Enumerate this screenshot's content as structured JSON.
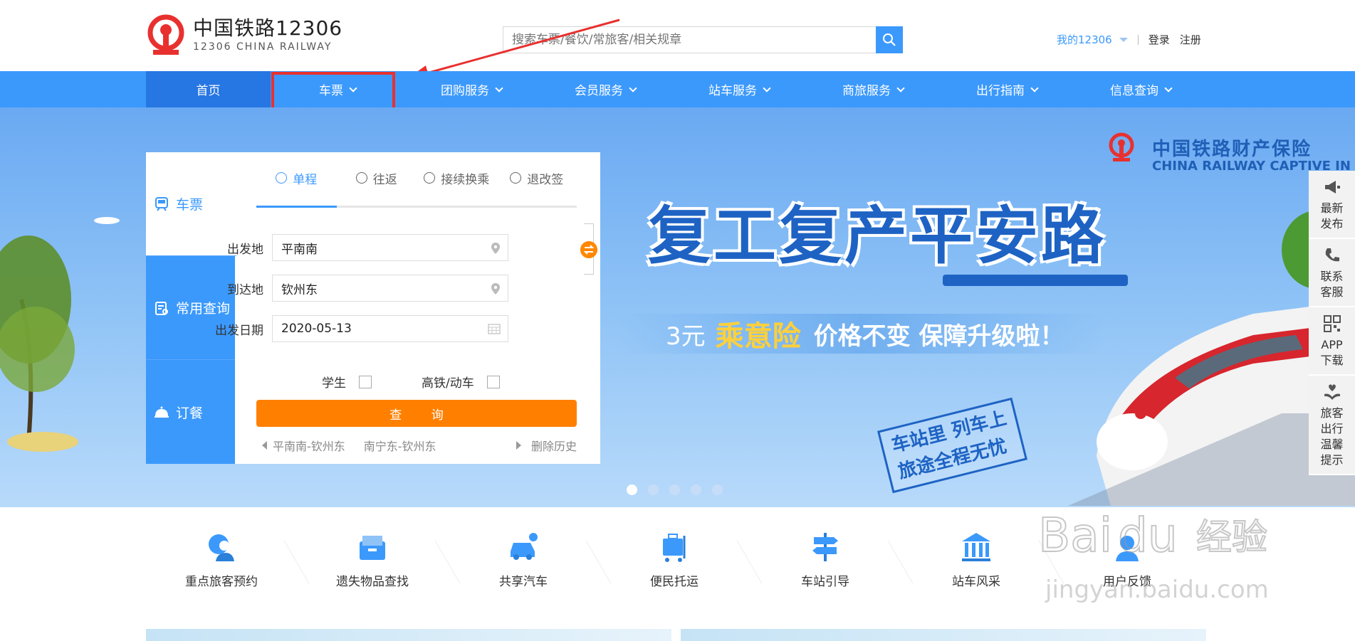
{
  "brand": {
    "name_cn": "中国铁路12306",
    "name_en": "12306 CHINA RAILWAY",
    "logo_color": "#e8312f"
  },
  "search": {
    "placeholder": "搜索车票/餐饮/常旅客/相关规章",
    "icon": "search-icon"
  },
  "top_links": {
    "my": "我的12306",
    "login": "登录",
    "register": "注册"
  },
  "nav": {
    "items": [
      {
        "label": "首页",
        "dropdown": false
      },
      {
        "label": "车票",
        "dropdown": true
      },
      {
        "label": "团购服务",
        "dropdown": true
      },
      {
        "label": "会员服务",
        "dropdown": true
      },
      {
        "label": "站车服务",
        "dropdown": true
      },
      {
        "label": "商旅服务",
        "dropdown": true
      },
      {
        "label": "出行指南",
        "dropdown": true
      },
      {
        "label": "信息查询",
        "dropdown": true
      }
    ],
    "accent": "#3b99fc",
    "active_bg": "#2676e3"
  },
  "booking": {
    "side_tabs": [
      {
        "label": "车票",
        "icon": "train-icon"
      },
      {
        "label": "常用查询",
        "icon": "clipboard-search-icon"
      },
      {
        "label": "订餐",
        "icon": "dining-bell-icon"
      }
    ],
    "trip_tabs": [
      {
        "label": "单程",
        "icon": "arrow-circle-icon"
      },
      {
        "label": "往返",
        "icon": "roundtrip-icon"
      },
      {
        "label": "接续换乘",
        "icon": "transfer-icon"
      },
      {
        "label": "退改签",
        "icon": "refund-icon"
      }
    ],
    "from_label": "出发地",
    "from_value": "平南南",
    "to_label": "到达地",
    "to_value": "钦州东",
    "date_label": "出发日期",
    "date_value": "2020-05-13",
    "student_label": "学生",
    "highspeed_label": "高铁/动车",
    "query_label": "查 询",
    "history": [
      "平南南-钦州东",
      "南宁东-钦州东"
    ],
    "delete_history": "删除历史",
    "query_color": "#ff8000"
  },
  "banner": {
    "insurer_cn": "中国铁路财产保险",
    "insurer_en": "CHINA RAILWAY CAPTIVE IN",
    "headline": "复工复产平安路",
    "subline_prefix": "3元",
    "subline_highlight": "乘意险",
    "subline_suffix": "价格不变 保障升级啦！",
    "badge_line1": "车站里 列车上",
    "badge_line2": "旅途全程无忧",
    "carousel_count": 5,
    "carousel_active": 1
  },
  "float_bar": [
    {
      "label": "最新发布",
      "icon": "megaphone-icon"
    },
    {
      "label": "联系客服",
      "icon": "phone-icon"
    },
    {
      "label": "APP下载",
      "icon": "qr-code-icon"
    },
    {
      "label": "旅客出行温馨提示",
      "icon": "heart-hands-icon"
    }
  ],
  "services": [
    {
      "label": "重点旅客预约",
      "icon": "priority-passenger-icon"
    },
    {
      "label": "遗失物品查找",
      "icon": "lost-found-icon"
    },
    {
      "label": "共享汽车",
      "icon": "shared-car-icon"
    },
    {
      "label": "便民托运",
      "icon": "luggage-cart-icon"
    },
    {
      "label": "车站引导",
      "icon": "signpost-icon"
    },
    {
      "label": "站车风采",
      "icon": "station-building-icon"
    },
    {
      "label": "用户反馈",
      "icon": "feedback-icon"
    }
  ],
  "watermark": {
    "brand": "Baidu",
    "cn": "经验",
    "url": "jingyan.baidu.com"
  }
}
